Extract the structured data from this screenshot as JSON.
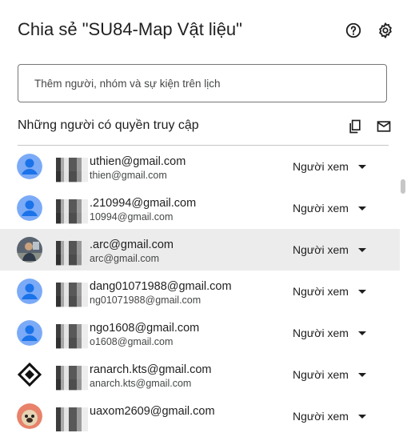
{
  "dialog": {
    "title": "Chia sẻ \"SU84-Map Vật liệu\"",
    "add_placeholder": "Thêm người, nhóm và sự kiện trên lịch",
    "section_title": "Những người có quyền truy cập"
  },
  "people": [
    {
      "email": "uthien@gmail.com",
      "sub": "thien@gmail.com",
      "role": "Người xem",
      "avatar": "default-avatar-icon"
    },
    {
      "email": ".210994@gmail.com",
      "sub": "10994@gmail.com",
      "role": "Người xem",
      "avatar": "default-avatar-icon"
    },
    {
      "email": ".arc@gmail.com",
      "sub": "arc@gmail.com",
      "role": "Người xem",
      "avatar": "photo-avatar"
    },
    {
      "email": "dang01071988@gmail.com",
      "sub": "ng01071988@gmail.com",
      "role": "Người xem",
      "avatar": "default-avatar-icon"
    },
    {
      "email": "ngo1608@gmail.com",
      "sub": "o1608@gmail.com",
      "role": "Người xem",
      "avatar": "default-avatar-icon"
    },
    {
      "email": "ranarch.kts@gmail.com",
      "sub": "anarch.kts@gmail.com",
      "role": "Người xem",
      "avatar": "logo-avatar"
    },
    {
      "email": "uaxom2609@gmail.com",
      "sub": "",
      "role": "Người xem",
      "avatar": "pug-avatar"
    }
  ],
  "colors": {
    "avatar_blue": "#7baaf7",
    "avatar_fg": "#1a73e8",
    "row_highlight": "#ececec"
  }
}
